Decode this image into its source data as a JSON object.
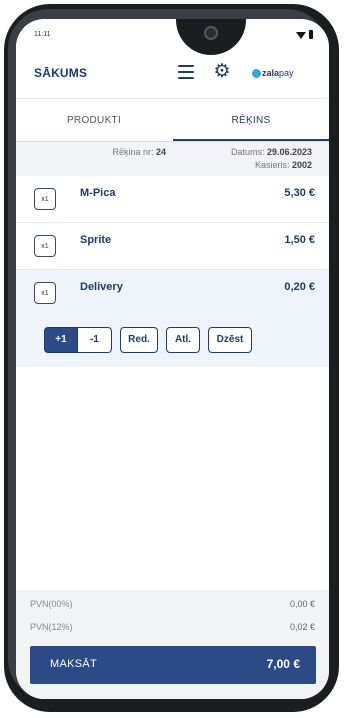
{
  "status_bar": {
    "time": "11:11"
  },
  "header": {
    "title": "SĀKUMS",
    "logo_part1": "zala",
    "logo_part2": "pay"
  },
  "tabs": [
    {
      "label": "PRODUKTI"
    },
    {
      "label": "RĒĶINS"
    }
  ],
  "info": {
    "receipt_label": "Rēķina nr: ",
    "receipt_no": "24",
    "date_label": "Datums: ",
    "date": "29.06.2023",
    "cashier_label": "Kasieris: ",
    "cashier": "2002"
  },
  "items": [
    {
      "qty": "x1",
      "name": "M-Pica",
      "price": "5,30 €"
    },
    {
      "qty": "x1",
      "name": "Sprite",
      "price": "1,50 €"
    },
    {
      "qty": "x1",
      "name": "Delivery",
      "price": "0,20 €"
    }
  ],
  "actions": {
    "plus": "+1",
    "minus": "-1",
    "edit": "Red.",
    "discount": "Atl.",
    "delete": "Dzēst"
  },
  "vat": [
    {
      "label": "PVN(00%)",
      "value": "0,00 €"
    },
    {
      "label": "PVN(12%)",
      "value": "0,02 €"
    }
  ],
  "pay": {
    "label": "MAKSĀT",
    "total": "7,00 €"
  },
  "colors": {
    "primary": "#2c4a85",
    "text_primary": "#1f3a6b",
    "selected_row": "#eef4fa"
  },
  "icons": [
    "menu-icon",
    "gear-icon",
    "wifi-icon",
    "battery-icon"
  ]
}
